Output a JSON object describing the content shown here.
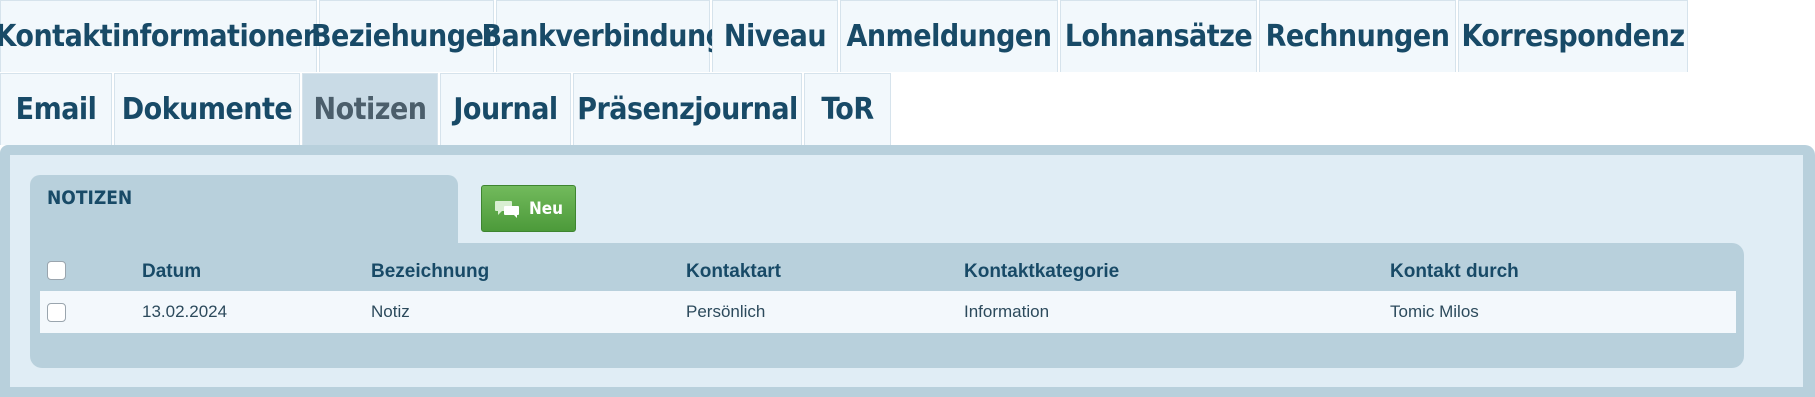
{
  "tabs": {
    "row1": [
      {
        "label": "Kontaktinformationen"
      },
      {
        "label": "Beziehungen"
      },
      {
        "label": "Bankverbindung"
      },
      {
        "label": "Niveau"
      },
      {
        "label": "Anmeldungen"
      },
      {
        "label": "Lohnansätze"
      },
      {
        "label": "Rechnungen"
      },
      {
        "label": "Korrespondenz"
      }
    ],
    "row2": [
      {
        "label": "Email"
      },
      {
        "label": "Dokumente"
      },
      {
        "label": "Notizen",
        "active": true
      },
      {
        "label": "Journal"
      },
      {
        "label": "Präsenzjournal"
      },
      {
        "label": "ToR"
      }
    ]
  },
  "section": {
    "title": "NOTIZEN",
    "new_button_label": "Neu",
    "new_button_icon": "comments-icon"
  },
  "table": {
    "columns": [
      "Datum",
      "Bezeichnung",
      "Kontaktart",
      "Kontaktkategorie",
      "Kontakt durch"
    ],
    "rows": [
      {
        "date": "13.02.2024",
        "title": "Notiz",
        "contact_type": "Persönlich",
        "category": "Information",
        "contact_by": "Tomic Milos"
      }
    ]
  },
  "colors": {
    "tab_text": "#184a67",
    "tab_background": "#f2f8fc",
    "active_tab_background": "#c9dbe6",
    "panel_frame": "#b8d0dc",
    "panel_background": "#e0edf5",
    "button_green": "#5aa845"
  }
}
